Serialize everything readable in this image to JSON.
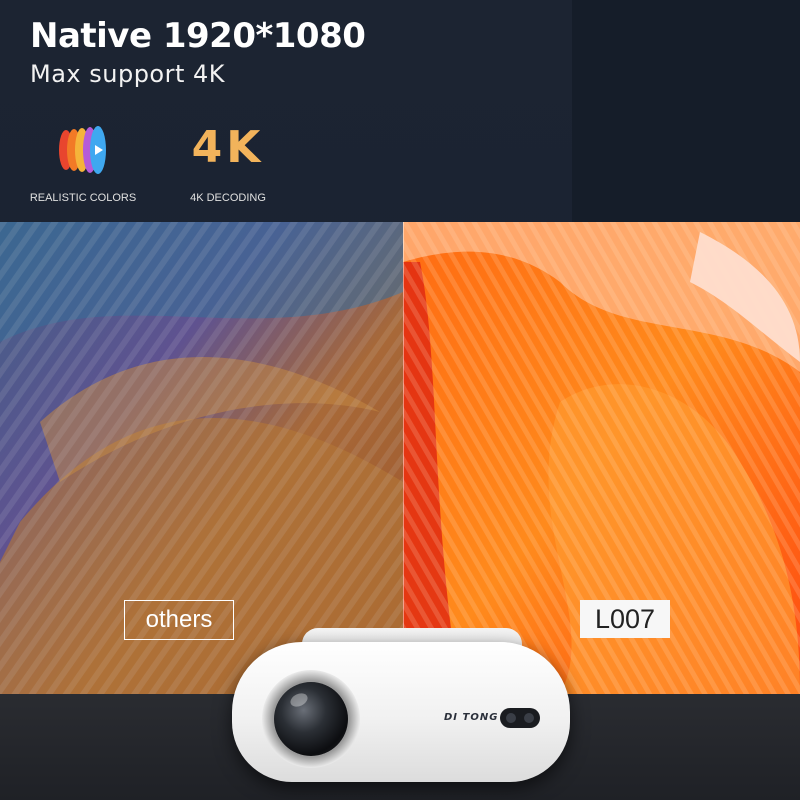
{
  "header": {
    "title": "Native 1920*1080",
    "subtitle": "Max support 4K"
  },
  "features": [
    {
      "label": "REALISTIC COLORS",
      "icon": "color-layers-icon"
    },
    {
      "label": "4K DECODING",
      "icon_text": "4K"
    }
  ],
  "comparison": {
    "left_label": "others",
    "right_label": "L007"
  },
  "product": {
    "brand": "DI TONG"
  },
  "colors": {
    "background": "#1c2432",
    "accent_4k": "#f2b35b"
  }
}
